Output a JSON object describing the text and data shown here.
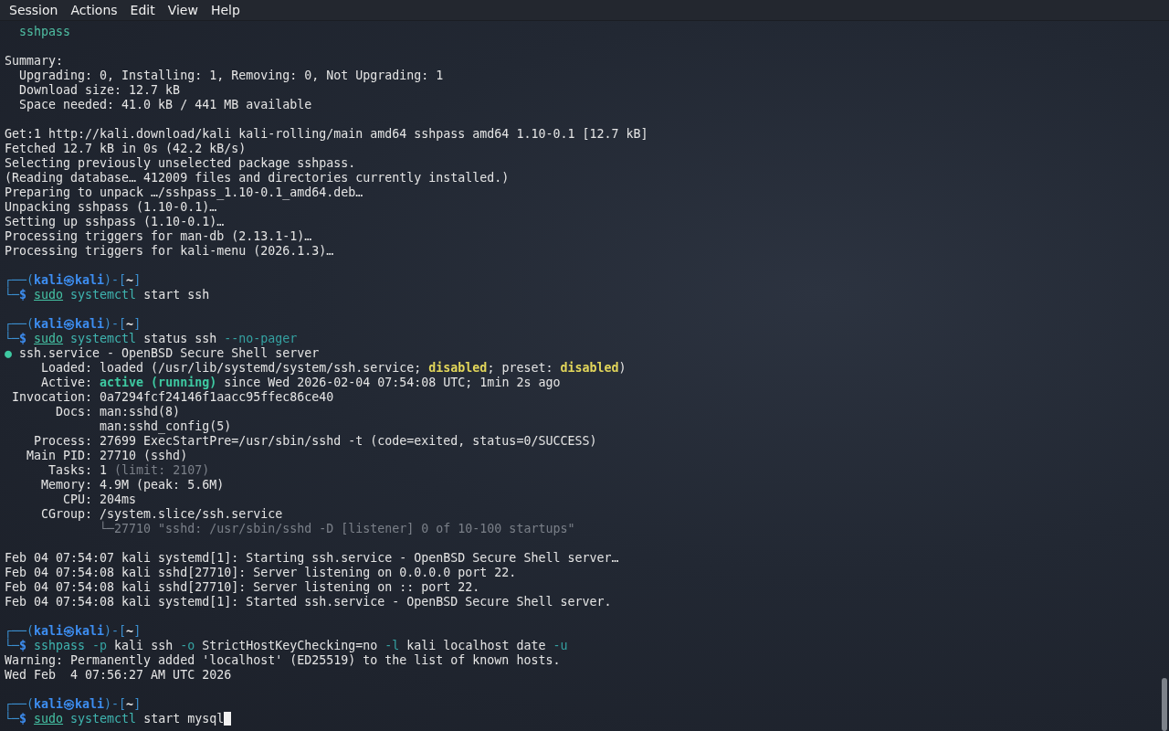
{
  "menu": [
    "Session",
    "Actions",
    "Edit",
    "View",
    "Help"
  ],
  "lines": [
    {
      "kind": "output",
      "segments": [
        {
          "text": "  sshpass",
          "kind": "package"
        }
      ]
    },
    {
      "kind": "blank"
    },
    {
      "kind": "output",
      "segments": [
        {
          "text": "Summary:",
          "kind": "plain"
        }
      ]
    },
    {
      "kind": "output",
      "segments": [
        {
          "text": "  Upgrading: 0, Installing: 1, Removing: 0, Not Upgrading: 1",
          "kind": "plain"
        }
      ]
    },
    {
      "kind": "output",
      "segments": [
        {
          "text": "  Download size: 12.7 kB",
          "kind": "plain"
        }
      ]
    },
    {
      "kind": "output",
      "segments": [
        {
          "text": "  Space needed: 41.0 kB / 441 MB available",
          "kind": "plain"
        }
      ]
    },
    {
      "kind": "blank"
    },
    {
      "kind": "output",
      "segments": [
        {
          "text": "Get:1 http://kali.download/kali kali-rolling/main amd64 sshpass amd64 1.10-0.1 [12.7 kB]",
          "kind": "plain"
        }
      ]
    },
    {
      "kind": "output",
      "segments": [
        {
          "text": "Fetched 12.7 kB in 0s (42.2 kB/s)",
          "kind": "plain"
        }
      ]
    },
    {
      "kind": "output",
      "segments": [
        {
          "text": "Selecting previously unselected package sshpass.",
          "kind": "plain"
        }
      ]
    },
    {
      "kind": "output",
      "segments": [
        {
          "text": "(Reading database… 412009 files and directories currently installed.)",
          "kind": "plain"
        }
      ]
    },
    {
      "kind": "output",
      "segments": [
        {
          "text": "Preparing to unpack …/sshpass_1.10-0.1_amd64.deb…",
          "kind": "plain"
        }
      ]
    },
    {
      "kind": "output",
      "segments": [
        {
          "text": "Unpacking sshpass (1.10-0.1)…",
          "kind": "plain"
        }
      ]
    },
    {
      "kind": "output",
      "segments": [
        {
          "text": "Setting up sshpass (1.10-0.1)…",
          "kind": "plain"
        }
      ]
    },
    {
      "kind": "output",
      "segments": [
        {
          "text": "Processing triggers for man-db (2.13.1-1)…",
          "kind": "plain"
        }
      ]
    },
    {
      "kind": "output",
      "segments": [
        {
          "text": "Processing triggers for kali-menu (2026.1.3)…",
          "kind": "plain"
        }
      ]
    },
    {
      "kind": "blank"
    },
    {
      "kind": "prompt",
      "segments": [
        {
          "text": "┌──(",
          "kind": "frame"
        },
        {
          "text": "kali㉿kali",
          "kind": "user"
        },
        {
          "text": ")-[",
          "kind": "frame"
        },
        {
          "text": "~",
          "kind": "dir"
        },
        {
          "text": "]",
          "kind": "frame"
        }
      ]
    },
    {
      "kind": "command",
      "segments": [
        {
          "text": "└─",
          "kind": "frame"
        },
        {
          "text": "$ ",
          "kind": "sign"
        },
        {
          "text": "sudo",
          "kind": "sudo"
        },
        {
          "text": "systemctl",
          "kind": "command"
        },
        {
          "text": " start ssh",
          "kind": "plain"
        }
      ]
    },
    {
      "kind": "blank"
    },
    {
      "kind": "prompt",
      "segments": [
        {
          "text": "┌──(",
          "kind": "frame"
        },
        {
          "text": "kali㉿kali",
          "kind": "user"
        },
        {
          "text": ")-[",
          "kind": "frame"
        },
        {
          "text": "~",
          "kind": "dir"
        },
        {
          "text": "]",
          "kind": "frame"
        }
      ]
    },
    {
      "kind": "command",
      "segments": [
        {
          "text": "└─",
          "kind": "frame"
        },
        {
          "text": "$ ",
          "kind": "sign"
        },
        {
          "text": "sudo",
          "kind": "sudo"
        },
        {
          "text": "systemctl",
          "kind": "command"
        },
        {
          "text": " status ssh ",
          "kind": "plain"
        },
        {
          "text": "--no-pager",
          "kind": "option"
        }
      ]
    },
    {
      "kind": "output",
      "segments": [
        {
          "text": "●",
          "kind": "active"
        },
        {
          "text": " ssh.service - OpenBSD Secure Shell server",
          "kind": "plain"
        }
      ]
    },
    {
      "kind": "output",
      "segments": [
        {
          "text": "     Loaded: loaded (/usr/lib/systemd/system/ssh.service; ",
          "kind": "plain"
        },
        {
          "text": "disabled",
          "kind": "flag"
        },
        {
          "text": "; preset: ",
          "kind": "plain"
        },
        {
          "text": "disabled",
          "kind": "flag"
        },
        {
          "text": ")",
          "kind": "plain"
        }
      ]
    },
    {
      "kind": "output",
      "segments": [
        {
          "text": "     Active: ",
          "kind": "plain"
        },
        {
          "text": "active (running)",
          "kind": "active"
        },
        {
          "text": " since Wed 2026-02-04 07:54:08 UTC; 1min 2s ago",
          "kind": "plain"
        }
      ]
    },
    {
      "kind": "output",
      "segments": [
        {
          "text": " Invocation: 0a7294fcf24146f1aacc95ffec86ce40",
          "kind": "plain"
        }
      ]
    },
    {
      "kind": "output",
      "segments": [
        {
          "text": "       Docs: man:sshd(8)",
          "kind": "plain"
        }
      ]
    },
    {
      "kind": "output",
      "segments": [
        {
          "text": "             man:sshd_config(5)",
          "kind": "plain"
        }
      ]
    },
    {
      "kind": "output",
      "segments": [
        {
          "text": "    Process: 27699 ExecStartPre=/usr/sbin/sshd -t (code=exited, status=0/SUCCESS)",
          "kind": "plain"
        }
      ]
    },
    {
      "kind": "output",
      "segments": [
        {
          "text": "   Main PID: 27710 (sshd)",
          "kind": "plain"
        }
      ]
    },
    {
      "kind": "output",
      "segments": [
        {
          "text": "      Tasks: 1 ",
          "kind": "plain"
        },
        {
          "text": "(limit: 2107)",
          "kind": "dim"
        }
      ]
    },
    {
      "kind": "output",
      "segments": [
        {
          "text": "     Memory: 4.9M (peak: 5.6M)",
          "kind": "plain"
        }
      ]
    },
    {
      "kind": "output",
      "segments": [
        {
          "text": "        CPU: 204ms",
          "kind": "plain"
        }
      ]
    },
    {
      "kind": "output",
      "segments": [
        {
          "text": "     CGroup: /system.slice/ssh.service",
          "kind": "plain"
        }
      ]
    },
    {
      "kind": "output",
      "segments": [
        {
          "text": "             └─27710 \"sshd: /usr/sbin/sshd -D [listener] 0 of 10-100 startups\"",
          "kind": "dim"
        }
      ]
    },
    {
      "kind": "blank"
    },
    {
      "kind": "output",
      "segments": [
        {
          "text": "Feb 04 07:54:07 kali systemd[1]: Starting ssh.service - OpenBSD Secure Shell server…",
          "kind": "plain"
        }
      ]
    },
    {
      "kind": "output",
      "segments": [
        {
          "text": "Feb 04 07:54:08 kali sshd[27710]: Server listening on 0.0.0.0 port 22.",
          "kind": "plain"
        }
      ]
    },
    {
      "kind": "output",
      "segments": [
        {
          "text": "Feb 04 07:54:08 kali sshd[27710]: Server listening on :: port 22.",
          "kind": "plain"
        }
      ]
    },
    {
      "kind": "output",
      "segments": [
        {
          "text": "Feb 04 07:54:08 kali systemd[1]: Started ssh.service - OpenBSD Secure Shell server.",
          "kind": "plain"
        }
      ]
    },
    {
      "kind": "blank"
    },
    {
      "kind": "prompt",
      "segments": [
        {
          "text": "┌──(",
          "kind": "frame"
        },
        {
          "text": "kali㉿kali",
          "kind": "user"
        },
        {
          "text": ")-[",
          "kind": "frame"
        },
        {
          "text": "~",
          "kind": "dir"
        },
        {
          "text": "]",
          "kind": "frame"
        }
      ]
    },
    {
      "kind": "command",
      "segments": [
        {
          "text": "└─",
          "kind": "frame"
        },
        {
          "text": "$ ",
          "kind": "sign"
        },
        {
          "text": "sshpass ",
          "kind": "command"
        },
        {
          "text": "-p",
          "kind": "option"
        },
        {
          "text": " kali ssh ",
          "kind": "plain"
        },
        {
          "text": "-o",
          "kind": "option"
        },
        {
          "text": " StrictHostKeyChecking=no ",
          "kind": "plain"
        },
        {
          "text": "-l",
          "kind": "option"
        },
        {
          "text": " kali localhost date ",
          "kind": "plain"
        },
        {
          "text": "-u",
          "kind": "option"
        }
      ]
    },
    {
      "kind": "output",
      "segments": [
        {
          "text": "Warning: Permanently added 'localhost' (ED25519) to the list of known hosts.",
          "kind": "plain"
        }
      ]
    },
    {
      "kind": "output",
      "segments": [
        {
          "text": "Wed Feb  4 07:56:27 AM UTC 2026",
          "kind": "plain"
        }
      ]
    },
    {
      "kind": "blank"
    },
    {
      "kind": "prompt",
      "segments": [
        {
          "text": "┌──(",
          "kind": "frame"
        },
        {
          "text": "kali㉿kali",
          "kind": "user"
        },
        {
          "text": ")-[",
          "kind": "frame"
        },
        {
          "text": "~",
          "kind": "dir"
        },
        {
          "text": "]",
          "kind": "frame"
        }
      ]
    },
    {
      "kind": "input",
      "segments": [
        {
          "text": "└─",
          "kind": "frame"
        },
        {
          "text": "$ ",
          "kind": "sign"
        },
        {
          "text": "sudo",
          "kind": "sudo"
        },
        {
          "text": "systemctl",
          "kind": "command"
        },
        {
          "text": " start mysql",
          "kind": "plain"
        }
      ]
    }
  ]
}
